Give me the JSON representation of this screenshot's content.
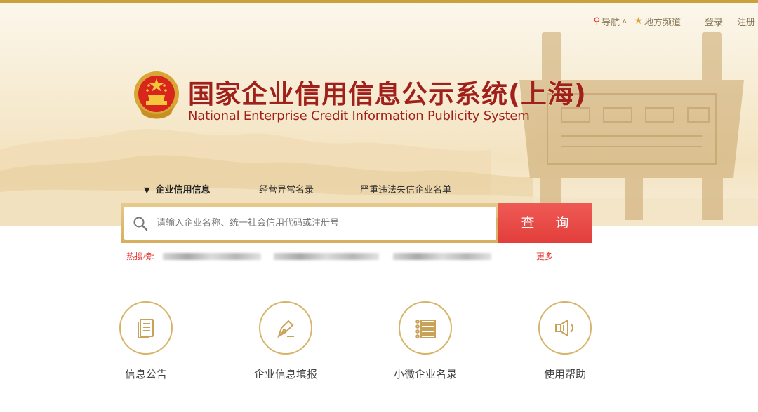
{
  "top_nav": {
    "nav_label": "导航",
    "local_label": "地方频道",
    "login_label": "登录",
    "register_label": "注册"
  },
  "header": {
    "title_cn": "国家企业信用信息公示系统(上海)",
    "title_en": "National Enterprise Credit Information Publicity System"
  },
  "tabs": [
    "企业信用信息",
    "经营异常名录",
    "严重违法失信企业名单"
  ],
  "search": {
    "placeholder": "请输入企业名称、统一社会信用代码或注册号",
    "button_label": "查 询"
  },
  "hot_search": {
    "label": "热搜榜:",
    "more_label": "更多"
  },
  "services": [
    {
      "label": "信息公告",
      "icon": "document-icon"
    },
    {
      "label": "企业信息填报",
      "icon": "pen-icon"
    },
    {
      "label": "小微企业名录",
      "icon": "list-icon"
    },
    {
      "label": "使用帮助",
      "icon": "speaker-icon"
    }
  ],
  "colors": {
    "brand_red": "#a0201a",
    "accent_gold": "#d6b46a",
    "button_red": "#e8494a",
    "hot_red": "#e0322a"
  }
}
